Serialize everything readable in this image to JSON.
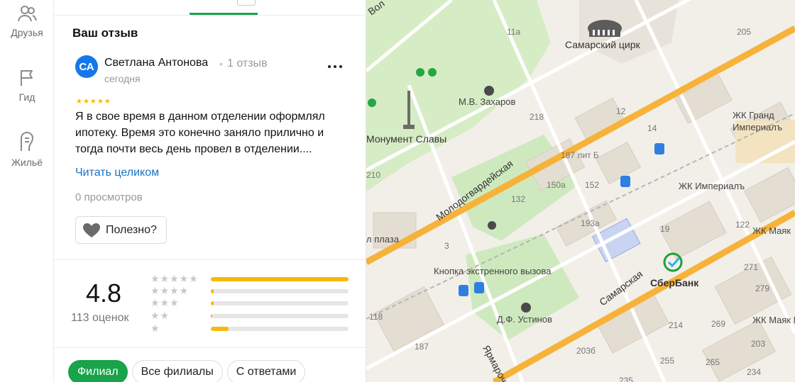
{
  "sidebar": {
    "items": [
      {
        "label": "Друзья",
        "icon": "friends-icon"
      },
      {
        "label": "Гид",
        "icon": "flag-icon"
      },
      {
        "label": "Жильё",
        "icon": "building-icon"
      }
    ]
  },
  "review": {
    "section_title": "Ваш отзыв",
    "avatar_initials": "СА",
    "author": "Светлана Антонова",
    "author_reviews": "1 отзыв",
    "date": "сегодня",
    "rating": 5,
    "text": "Я в свое время в данном отделении оформлял ипотеку. Время это конечно заняло прилично и тогда почти весь день провел в отделении....",
    "read_more": "Читать целиком",
    "views": "0 просмотров",
    "useful_label": "Полезно?"
  },
  "summary": {
    "rating": "4.8",
    "count": "113 оценок",
    "distribution": [
      {
        "stars": "★★★★★",
        "fraction": 1.0
      },
      {
        "stars": "★★★★",
        "fraction": 0.02
      },
      {
        "stars": "★★★",
        "fraction": 0.02
      },
      {
        "stars": "★★",
        "fraction": 0.01
      },
      {
        "stars": "★",
        "fraction": 0.13
      }
    ]
  },
  "filters": [
    {
      "label": "Филиал",
      "active": true
    },
    {
      "label": "Все филиалы",
      "active": false
    },
    {
      "label": "С ответами",
      "active": false
    }
  ],
  "map": {
    "labels": {
      "circus": "Самарский цирк",
      "zakharov": "М.В. Захаров",
      "monument": "Монумент Славы",
      "grand": "ЖК Гранд Империалъ",
      "imperial": "ЖК Империалъ",
      "button": "Кнопка экстренного вызова",
      "ustinov": "Д.Ф. Устинов",
      "sberbank": "СберБанк",
      "plaza": "л плаза",
      "mayak1": "ЖК Маяк",
      "mayak2": "ЖК Маяк Ne"
    },
    "streets": {
      "molodogvardeyskaya": "Молодогвардейская",
      "samarskaya": "Самарская",
      "yarmarochnaya": "Ярмарочная",
      "vol": "Вол"
    },
    "numbers": [
      "11а",
      "205",
      "218",
      "12",
      "14",
      "187 лит Б",
      "150а",
      "152",
      "132",
      "193а",
      "19",
      "122",
      "210",
      "3",
      "118",
      "271",
      "279",
      "214",
      "269",
      "203",
      "187",
      "203б",
      "255",
      "265",
      "234",
      "235"
    ],
    "colors": {
      "road": "#f7b23a",
      "park": "#cfe9bf",
      "park_dark": "#b7dca1",
      "building": "#e4ddd2"
    }
  }
}
